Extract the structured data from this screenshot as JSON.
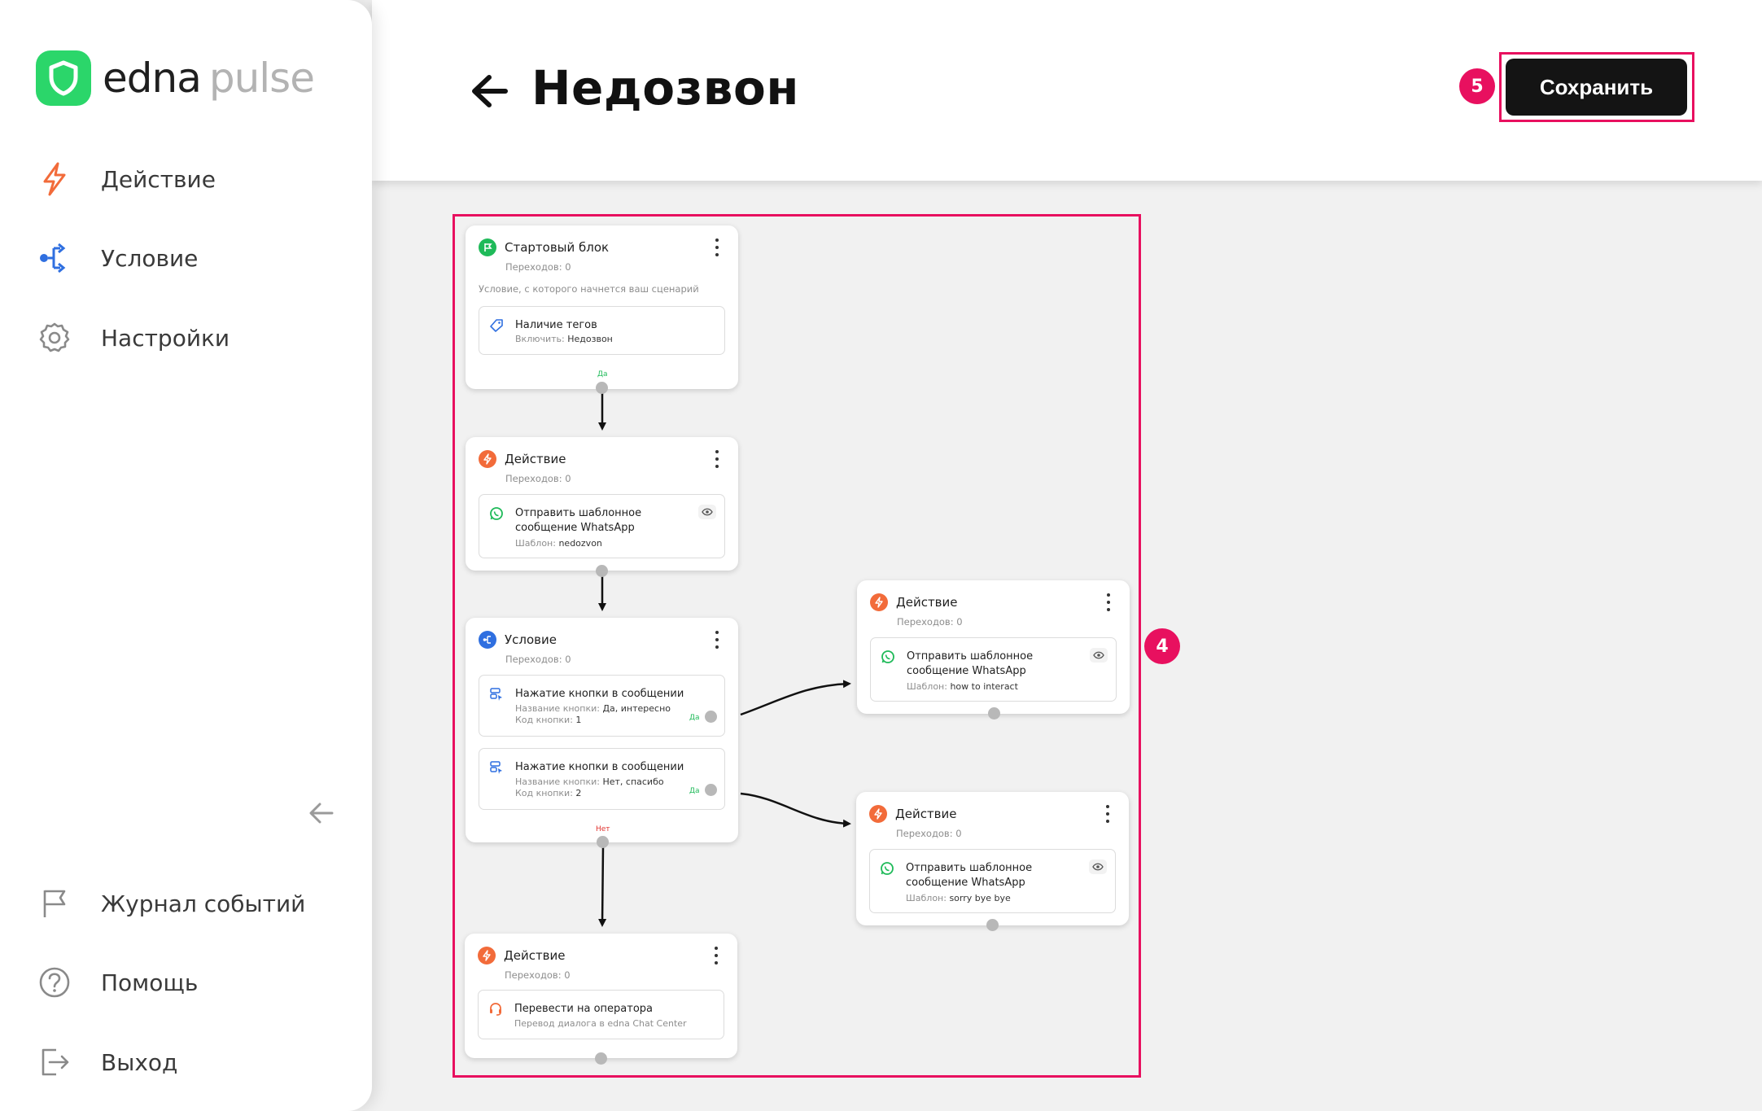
{
  "brand": {
    "name_part1": "edna",
    "name_part2": "pulse",
    "accent": "#2bd66a"
  },
  "sidebar": {
    "items": [
      {
        "label": "Действие",
        "icon": "lightning-icon"
      },
      {
        "label": "Условие",
        "icon": "branch-icon"
      },
      {
        "label": "Настройки",
        "icon": "gear-icon"
      }
    ],
    "bottom_items": [
      {
        "label": "Журнал событий",
        "icon": "flag-icon"
      },
      {
        "label": "Помощь",
        "icon": "help-icon"
      },
      {
        "label": "Выход",
        "icon": "logout-icon"
      }
    ]
  },
  "header": {
    "title": "Недозвон",
    "save_label": "Сохранить"
  },
  "annotations": {
    "save_badge": "5",
    "canvas_badge": "4",
    "highlight_color": "#e8105f"
  },
  "flow": {
    "start": {
      "title": "Стартовый блок",
      "transitions": "Переходов: 0",
      "description": "Условие, с которого начнется ваш сценарий",
      "condition_title": "Наличие тегов",
      "condition_sub_label": "Включить:",
      "condition_sub_value": "Недозвон",
      "yes": "Да"
    },
    "action1": {
      "title": "Действие",
      "transitions": "Переходов: 0",
      "item_title_line1": "Отправить шаблонное",
      "item_title_line2": "сообщение WhatsApp",
      "item_sub_label": "Шаблон:",
      "item_sub_value": "nedozvon"
    },
    "condition": {
      "title": "Условие",
      "transitions": "Переходов: 0",
      "branches": [
        {
          "title": "Нажатие кнопки в сообщении",
          "name_label": "Название кнопки:",
          "name_value": "Да, интересно",
          "code_label": "Код кнопки:",
          "code_value": "1",
          "yes": "Да"
        },
        {
          "title": "Нажатие кнопки в сообщении",
          "name_label": "Название кнопки:",
          "name_value": "Нет, спасибо",
          "code_label": "Код кнопки:",
          "code_value": "2",
          "yes": "Да"
        }
      ],
      "no": "Нет"
    },
    "action_right1": {
      "title": "Действие",
      "transitions": "Переходов: 0",
      "item_title_line1": "Отправить шаблонное",
      "item_title_line2": "сообщение WhatsApp",
      "item_sub_label": "Шаблон:",
      "item_sub_value": "how to interact"
    },
    "action_right2": {
      "title": "Действие",
      "transitions": "Переходов: 0",
      "item_title_line1": "Отправить шаблонное",
      "item_title_line2": "сообщение WhatsApp",
      "item_sub_label": "Шаблон:",
      "item_sub_value": "sorry bye bye"
    },
    "action_bottom": {
      "title": "Действие",
      "transitions": "Переходов: 0",
      "item_title": "Перевести на оператора",
      "item_sub": "Перевод диалога в edna Chat Center"
    }
  }
}
